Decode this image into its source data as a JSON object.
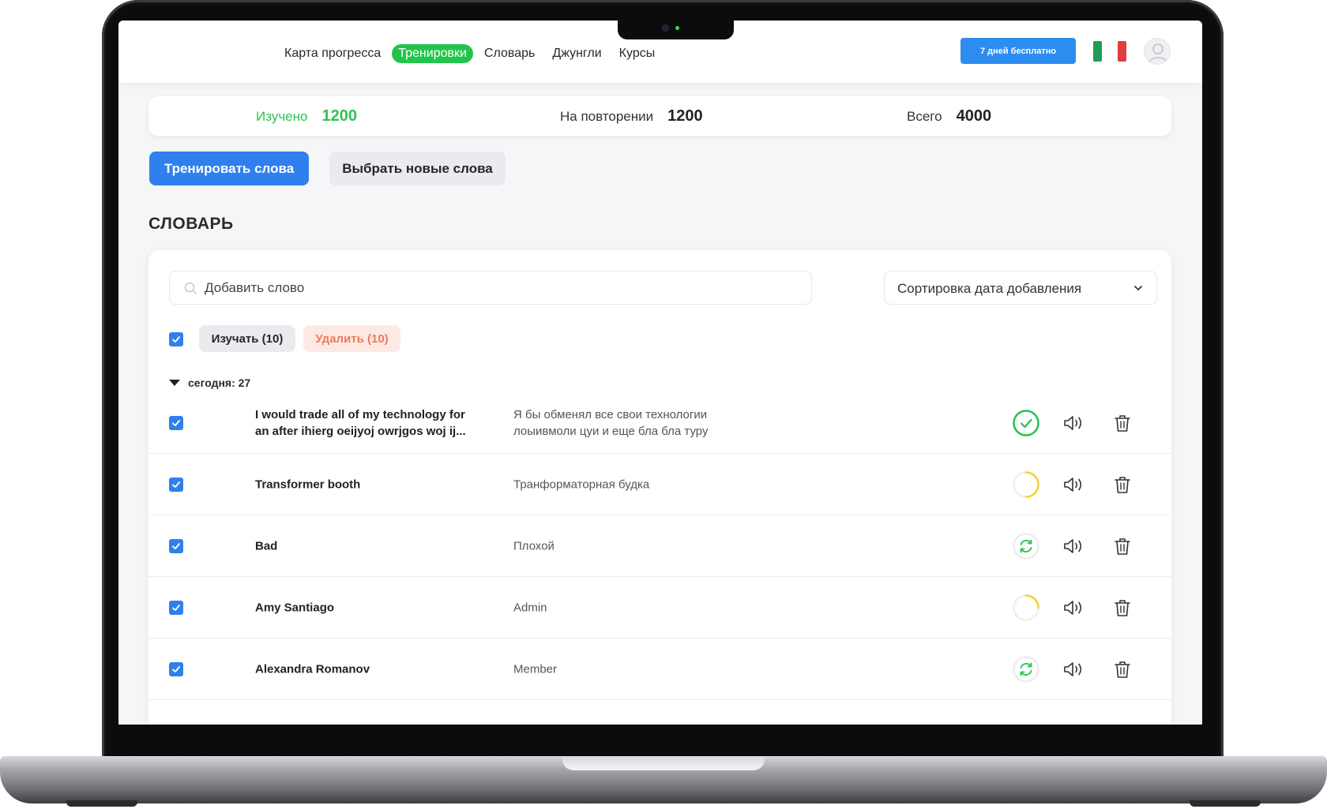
{
  "nav": {
    "items": [
      {
        "label": "Карта прогресса",
        "active": false
      },
      {
        "label": "Тренировки",
        "active": true
      },
      {
        "label": "Словарь",
        "active": false
      },
      {
        "label": "Джунгли",
        "active": false
      },
      {
        "label": "Курсы",
        "active": false
      }
    ],
    "trial_label": "7 дней бесплатно",
    "flag_colors": [
      "#1f9d55",
      "#ffffff",
      "#e03c41"
    ]
  },
  "stats": {
    "learned_label": "Изучено",
    "learned_value": "1200",
    "review_label": "На повторении",
    "review_value": "1200",
    "total_label": "Всего",
    "total_value": "4000"
  },
  "actions": {
    "train_label": "Тренировать слова",
    "choose_label": "Выбрать новые слова"
  },
  "dictionary": {
    "title": "СЛОВАРЬ",
    "search_placeholder": "Добавить слово",
    "sort_label": "Сортировка дата добавления",
    "study_label": "Изучать (10)",
    "delete_label": "Удалить (10)",
    "group_label": "сегодня: 27",
    "rows": [
      {
        "word": "I would trade all of my technology for an after ihierg oeijyoj owrjgos woj ij...",
        "translation": "Я бы обменял все свои технологии лоыивмоли цуи и еще бла бла туру",
        "status": "learned"
      },
      {
        "word": "Transformer booth",
        "translation": "Транформаторная будка",
        "status": "progress-half"
      },
      {
        "word": "Bad",
        "translation": "Плохой",
        "status": "review"
      },
      {
        "word": "Amy Santiago",
        "translation": "Admin",
        "status": "progress-quarter"
      },
      {
        "word": "Alexandra Romanov",
        "translation": "Member",
        "status": "review"
      }
    ]
  },
  "colors": {
    "accent": "#2f80ed",
    "green": "#22c44b",
    "yellow": "#f5d12a",
    "danger": "#f07a5c"
  }
}
